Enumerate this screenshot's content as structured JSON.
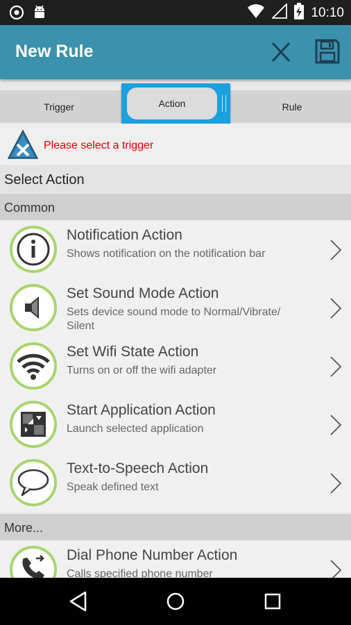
{
  "status_bar": {
    "time": "10:10",
    "icons": [
      "target-icon",
      "android-icon",
      "wifi-icon",
      "signal-icon",
      "battery-charging-icon"
    ]
  },
  "app_bar": {
    "title": "New Rule",
    "close_icon": "close-icon",
    "save_icon": "save-icon"
  },
  "tabs": [
    {
      "label": "Trigger",
      "selected": false
    },
    {
      "label": "Action",
      "selected": true
    },
    {
      "label": "Rule",
      "selected": false
    }
  ],
  "warning": {
    "icon": "warning-x-icon",
    "text": "Please select a trigger",
    "color": "#e00000"
  },
  "section_title": "Select Action",
  "groups": {
    "common": "Common",
    "more": "More..."
  },
  "actions": [
    {
      "icon": "info-icon",
      "title": "Notification Action",
      "description": "Shows notification on the notification bar"
    },
    {
      "icon": "speaker-icon",
      "title": "Set Sound Mode Action",
      "description": "Sets device sound mode to Normal/Vibrate/\nSilent"
    },
    {
      "icon": "wifi-icon",
      "title": "Set Wifi State Action",
      "description": "Turns on or off the wifi adapter"
    },
    {
      "icon": "app-launch-icon",
      "title": "Start Application Action",
      "description": "Launch selected application"
    },
    {
      "icon": "speech-bubble-icon",
      "title": "Text-to-Speech Action",
      "description": "Speak defined text"
    }
  ],
  "more_actions": [
    {
      "icon": "phone-call-icon",
      "title": "Dial Phone Number Action",
      "description": "Calls specified phone number"
    }
  ],
  "colors": {
    "app_bar": "#3c91ad",
    "tab_highlight": "#1aa0dd",
    "icon_ring": "#a8d46f",
    "warning_text": "#e00000"
  },
  "nav_bar": {
    "icons": [
      "back-icon",
      "home-icon",
      "recent-apps-icon"
    ]
  }
}
